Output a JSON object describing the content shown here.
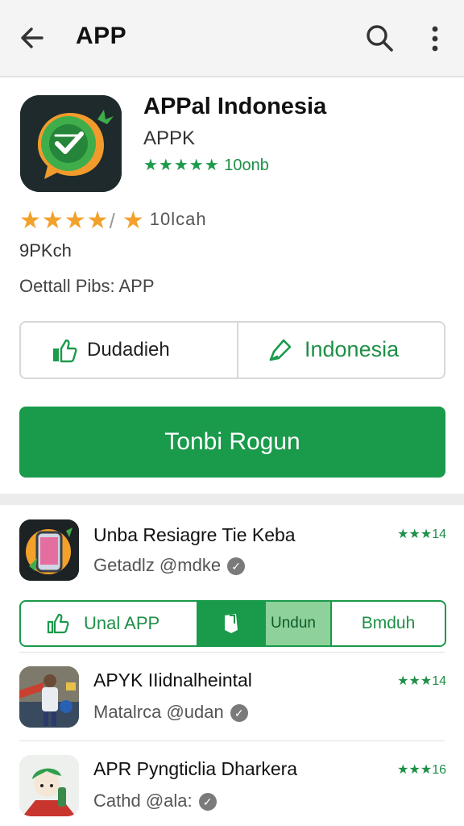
{
  "topbar": {
    "title": "APP",
    "back_icon": "arrow-left-icon",
    "search_icon": "search-icon",
    "more_icon": "more-vert-icon"
  },
  "app": {
    "name": "APPal Indonesia",
    "developer": "APPK",
    "small_rating_stars": "★★★★★",
    "small_rating_text": "10onb",
    "big_stars": "★★★★",
    "big_rating_slash": "/",
    "big_rating_extra_star": "★",
    "big_rating_count": "10lcah",
    "size_text": "9PKch",
    "detail_text": "Oettall Pibs: APP"
  },
  "actions": {
    "left_label": "Dudadieh",
    "right_label": "Indonesia",
    "install_label": "Tonbi Rogun"
  },
  "list": [
    {
      "title": "Unba Resiagre Tie Keba",
      "subtitle": "Getadlz @mdke",
      "rating": "★★★14"
    },
    {
      "title": "APYK IIidnalheintal",
      "subtitle": "Matalrca @udan",
      "rating": "★★★14"
    },
    {
      "title": "APR Pyngticlia Dharkera",
      "subtitle": "Cathd @ala:",
      "rating": "★★★16"
    }
  ],
  "segment": {
    "a_label": "Unal APP",
    "c_label": "Undun",
    "d_label": "Bmduh"
  },
  "colors": {
    "accent_green": "#1a9a4b",
    "star_orange": "#f2a12b"
  }
}
